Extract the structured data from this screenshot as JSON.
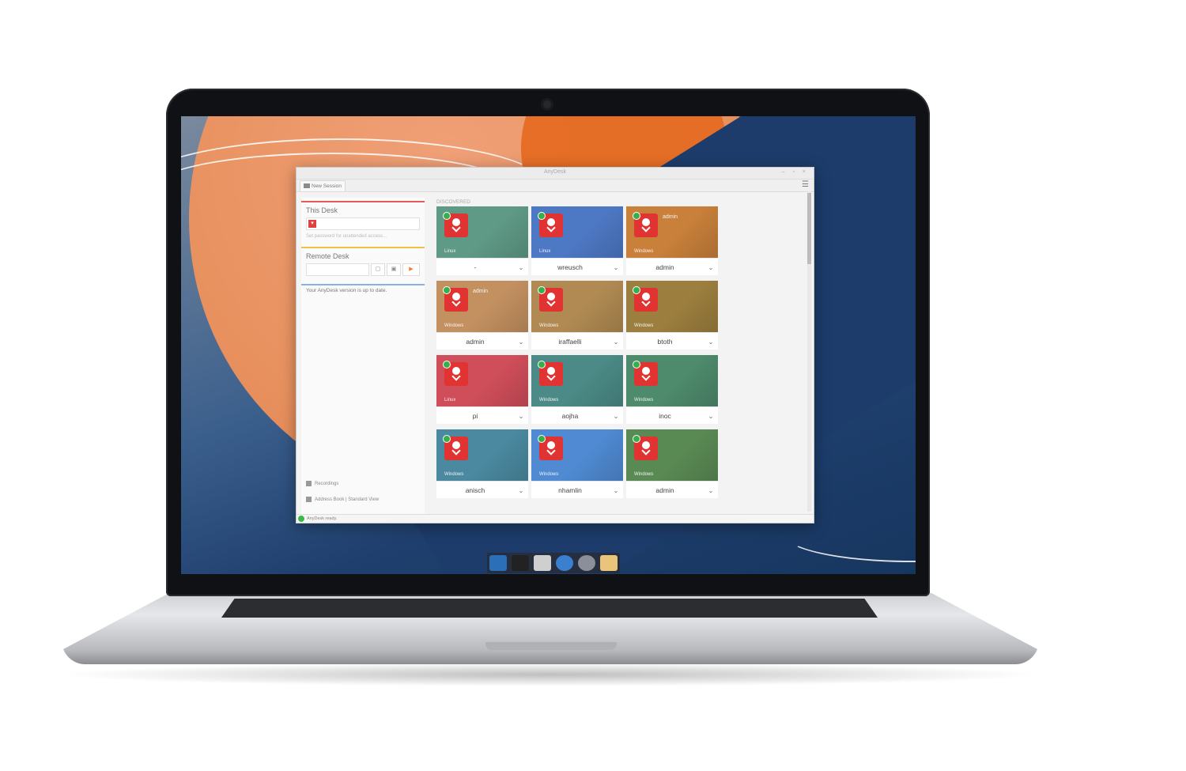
{
  "app": {
    "title": "AnyDesk"
  },
  "tab": {
    "label": "New Session"
  },
  "this_desk": {
    "title": "This Desk",
    "link": "Set password for unattended access..."
  },
  "remote_desk": {
    "title": "Remote Desk"
  },
  "version_status": "Your AnyDesk version is up to date.",
  "links": {
    "recordings": "Recordings",
    "address_book": "Address Book",
    "standard_view": "Standard View"
  },
  "status_bar": "AnyDesk ready.",
  "discovered_label": "DISCOVERED",
  "devices": [
    {
      "name": "-",
      "os": "Linux",
      "inner_user": "",
      "color": "#5f9a86"
    },
    {
      "name": "wreusch",
      "os": "Linux",
      "inner_user": "",
      "color": "#4d78c4"
    },
    {
      "name": "admin",
      "os": "Windows",
      "inner_user": "admin",
      "color": "#c8803a"
    },
    {
      "name": "admin",
      "os": "Windows",
      "inner_user": "admin",
      "color": "#c39060"
    },
    {
      "name": "iraffaelli",
      "os": "Windows",
      "inner_user": "",
      "color": "#b08a52"
    },
    {
      "name": "btoth",
      "os": "Windows",
      "inner_user": "",
      "color": "#9c7f3e"
    },
    {
      "name": "pi",
      "os": "Linux",
      "inner_user": "",
      "color": "#cf4e5a"
    },
    {
      "name": "aojha",
      "os": "Windows",
      "inner_user": "",
      "color": "#4b8a86"
    },
    {
      "name": "inoc",
      "os": "Windows",
      "inner_user": "",
      "color": "#4e8a6c"
    },
    {
      "name": "anisch",
      "os": "Windows",
      "inner_user": "",
      "color": "#4a89a0"
    },
    {
      "name": "nhamlin",
      "os": "Windows",
      "inner_user": "",
      "color": "#4f8ad2"
    },
    {
      "name": "admin",
      "os": "Windows",
      "inner_user": "",
      "color": "#5a8a54"
    }
  ],
  "icons": [
    "screen-icon",
    "terminal-icon",
    "home-folder-icon",
    "globe-icon",
    "search-icon",
    "folder-icon"
  ]
}
